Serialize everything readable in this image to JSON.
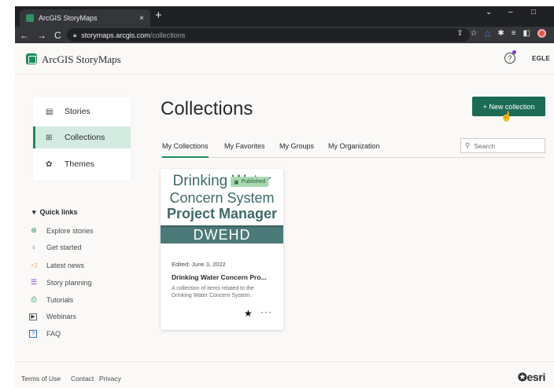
{
  "browser": {
    "tab_title": "ArcGIS StoryMaps",
    "tab_close": "×",
    "new_tab": "+",
    "url_host": "storymaps.arcgis.com",
    "url_path": "/collections",
    "nav_back": "←",
    "nav_forward": "→",
    "nav_reload": "C",
    "win_minimize": "–",
    "win_maximize": "□",
    "win_chevron": "⌄"
  },
  "header": {
    "app_title": "ArcGIS StoryMaps",
    "help_glyph": "?",
    "user_initials": "EGLE"
  },
  "sidebar": {
    "items": [
      {
        "label": "Stories",
        "icon": "stories-icon",
        "glyph": "▤"
      },
      {
        "label": "Collections",
        "icon": "grid-icon",
        "glyph": "⊞"
      },
      {
        "label": "Themes",
        "icon": "palette-icon",
        "glyph": "✿"
      }
    ]
  },
  "quick_links": {
    "heading": "Quick links",
    "items": [
      {
        "label": "Explore stories",
        "glyph": "⊛",
        "color": "#1f8a5c"
      },
      {
        "label": "Get started",
        "glyph": "♀",
        "color": "#2d6fd1"
      },
      {
        "label": "Latest news",
        "glyph": "◁",
        "color": "#e6a23c"
      },
      {
        "label": "Story planning",
        "glyph": "☰",
        "color": "#7c3bd6"
      },
      {
        "label": "Tutorials",
        "glyph": "⎙",
        "color": "#1f8a5c"
      },
      {
        "label": "Webinars",
        "glyph": "▶",
        "color": "#444444"
      },
      {
        "label": "FAQ",
        "glyph": "?",
        "color": "#2d6fd1"
      }
    ]
  },
  "main": {
    "title": "Collections",
    "new_button": "+ New collection",
    "tabs": [
      "My Collections",
      "My Favorites",
      "My Groups",
      "My Organization"
    ],
    "search_placeholder": "Search"
  },
  "card": {
    "thumb_line1": "Drinking Water",
    "thumb_line2": "Concern System",
    "thumb_line3": "Project Manager",
    "thumb_band": "DWEHD",
    "badge": "Published",
    "edited": "Edited: June 3, 2022",
    "title": "Drinking Water Concern Pro...",
    "description": "A collection of items related to the Drinking Water Concern System.",
    "star": "★",
    "more": "···"
  },
  "footer": {
    "links": [
      "Terms of Use",
      "Contact",
      "Privacy"
    ],
    "brand": "esri"
  },
  "colors": {
    "brand_green": "#1f8a5c",
    "button_green": "#1c6b55",
    "active_bg": "#d4ebe2",
    "thumb_teal": "#4b7a78",
    "badge_green": "#a9d9b1"
  }
}
